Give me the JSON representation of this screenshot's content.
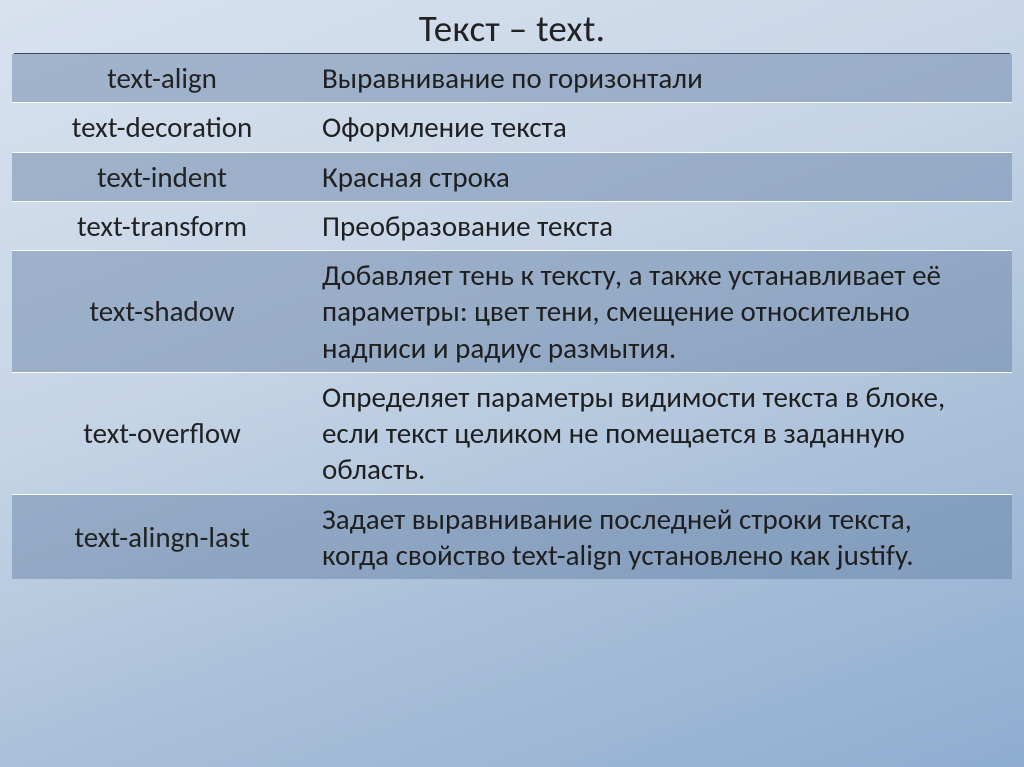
{
  "title": "Текст – text.",
  "rows": [
    {
      "prop": "text-align",
      "desc": "Выравнивание по горизонтали",
      "shade": "dark"
    },
    {
      "prop": "text-decoration",
      "desc": "Оформление текста",
      "shade": "light"
    },
    {
      "prop": "text-indent",
      "desc": "Красная строка",
      "shade": "dark"
    },
    {
      "prop": "text-transform",
      "desc": "Преобразование текста",
      "shade": "light"
    },
    {
      "prop": "text-shadow",
      "desc": "Добавляет тень к тексту, а также устанавливает её параметры: цвет тени, смещение относительно надписи и радиус размытия.",
      "shade": "dark"
    },
    {
      "prop": "text-overflow",
      "desc": "Определяет параметры видимости текста в блоке, если текст целиком не помещается в заданную область.",
      "shade": "light"
    },
    {
      "prop": "text-alingn-last",
      "desc": "Задает выравнивание последней строки текста, когда свойство text-align установлено как justify.",
      "shade": "dark"
    }
  ]
}
